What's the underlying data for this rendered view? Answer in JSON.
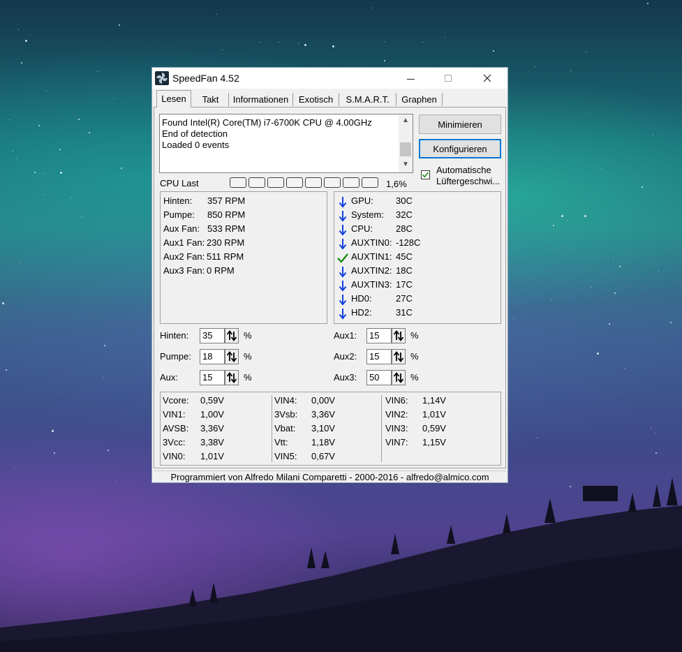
{
  "window": {
    "title": "SpeedFan 4.52"
  },
  "tabs": [
    "Lesen",
    "Takt",
    "Informationen",
    "Exotisch",
    "S.M.A.R.T.",
    "Graphen"
  ],
  "log": {
    "lines": [
      "Found Intel(R) Core(TM) i7-6700K CPU @ 4.00GHz",
      "End of detection",
      "Loaded 0 events"
    ]
  },
  "buttons": {
    "minimize": "Minimieren",
    "configure": "Konfigurieren"
  },
  "auto_fan": {
    "label_line1": "Automatische",
    "label_line2": "Lüftergeschwi...",
    "checked": true
  },
  "cpu_load": {
    "label": "CPU Last",
    "value": "1,6%",
    "fraction": 0.016
  },
  "fans": [
    {
      "label": "Hinten:",
      "value": "357 RPM"
    },
    {
      "label": "Pumpe:",
      "value": "850 RPM"
    },
    {
      "label": "Aux Fan:",
      "value": "533 RPM"
    },
    {
      "label": "Aux1 Fan:",
      "value": "230 RPM"
    },
    {
      "label": "Aux2 Fan:",
      "value": "511 RPM"
    },
    {
      "label": "Aux3 Fan:",
      "value": "0 RPM"
    }
  ],
  "temps": [
    {
      "label": "GPU:",
      "value": "30C",
      "icon": "arrow-down-icon"
    },
    {
      "label": "System:",
      "value": "32C",
      "icon": "arrow-down-icon"
    },
    {
      "label": "CPU:",
      "value": "28C",
      "icon": "arrow-down-icon"
    },
    {
      "label": "AUXTIN0:",
      "value": "-128C",
      "icon": "arrow-down-icon"
    },
    {
      "label": "AUXTIN1:",
      "value": "45C",
      "icon": "checkmark-icon"
    },
    {
      "label": "AUXTIN2:",
      "value": "18C",
      "icon": "arrow-down-icon"
    },
    {
      "label": "AUXTIN3:",
      "value": "17C",
      "icon": "arrow-down-icon"
    },
    {
      "label": "HD0:",
      "value": "27C",
      "icon": "arrow-down-icon"
    },
    {
      "label": "HD2:",
      "value": "31C",
      "icon": "arrow-down-icon"
    }
  ],
  "speeds": [
    {
      "label": "Hinten:",
      "value": "35",
      "unit": "%"
    },
    {
      "label": "Pumpe:",
      "value": "18",
      "unit": "%"
    },
    {
      "label": "Aux:",
      "value": "15",
      "unit": "%"
    },
    {
      "label": "Aux1:",
      "value": "15",
      "unit": "%"
    },
    {
      "label": "Aux2:",
      "value": "15",
      "unit": "%"
    },
    {
      "label": "Aux3:",
      "value": "50",
      "unit": "%"
    }
  ],
  "voltages": [
    [
      {
        "label": "Vcore:",
        "value": "0,59V"
      },
      {
        "label": "VIN1:",
        "value": "1,00V"
      },
      {
        "label": "AVSB:",
        "value": "3,36V"
      },
      {
        "label": "3Vcc:",
        "value": "3,38V"
      },
      {
        "label": "VIN0:",
        "value": "1,01V"
      }
    ],
    [
      {
        "label": "VIN4:",
        "value": "0,00V"
      },
      {
        "label": "3Vsb:",
        "value": "3,36V"
      },
      {
        "label": "Vbat:",
        "value": "3,10V"
      },
      {
        "label": "Vtt:",
        "value": "1,18V"
      },
      {
        "label": "VIN5:",
        "value": "0,67V"
      }
    ],
    [
      {
        "label": "VIN6:",
        "value": "1,14V"
      },
      {
        "label": "VIN2:",
        "value": "1,01V"
      },
      {
        "label": "VIN3:",
        "value": "0,59V"
      },
      {
        "label": "VIN7:",
        "value": "1,15V"
      }
    ]
  ],
  "footer": "Programmiert von Alfredo Milani Comparetti - 2000-2016 - alfredo@almico.com",
  "colors": {
    "arrow": "#1040e0",
    "check": "#1a8a1a",
    "focus": "#0078d7"
  }
}
